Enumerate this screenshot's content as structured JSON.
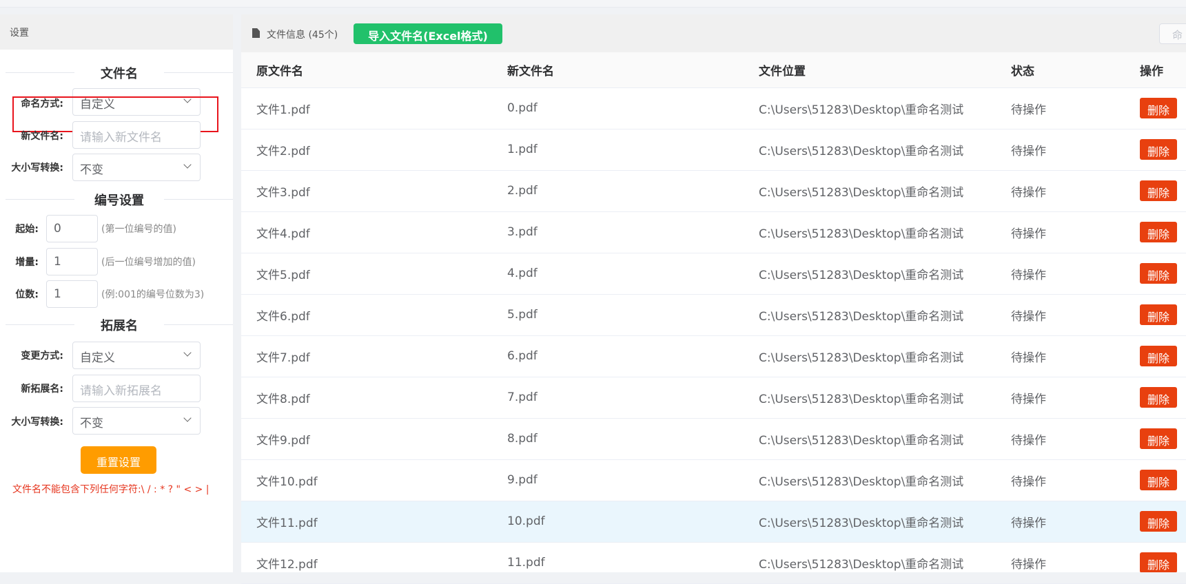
{
  "settings": {
    "title": "设置",
    "filename_section": "文件名",
    "naming_label": "命名方式:",
    "naming_value": "自定义",
    "newname_label": "新文件名:",
    "newname_placeholder": "请输入新文件名",
    "case_label": "大小写转换:",
    "case_value": "不变",
    "numbering_section": "编号设置",
    "start_label": "起始:",
    "start_value": "0",
    "start_hint": "(第一位编号的值)",
    "increment_label": "增量:",
    "increment_value": "1",
    "increment_hint": "(后一位编号增加的值)",
    "digits_label": "位数:",
    "digits_value": "1",
    "digits_hint": "(例:001的编号位数为3)",
    "ext_section": "拓展名",
    "ext_mode_label": "变更方式:",
    "ext_mode_value": "自定义",
    "newext_label": "新拓展名:",
    "newext_placeholder": "请输入新拓展名",
    "ext_case_label": "大小写转换:",
    "ext_case_value": "不变",
    "reset_label": "重置设置",
    "warning": "文件名不能包含下列任何字符:\\ / : * ? \" < > |"
  },
  "toolbar": {
    "info": "文件信息 (45个)",
    "import_label": "导入文件名(Excel格式)",
    "rename_label": "命"
  },
  "table": {
    "headers": [
      "原文件名",
      "新文件名",
      "文件位置",
      "状态",
      "操作"
    ],
    "delete_label": "删除",
    "rows": [
      {
        "orig": "文件1.pdf",
        "new": "0.pdf",
        "path": "C:\\Users\\51283\\Desktop\\重命名测试",
        "status": "待操作"
      },
      {
        "orig": "文件2.pdf",
        "new": "1.pdf",
        "path": "C:\\Users\\51283\\Desktop\\重命名测试",
        "status": "待操作"
      },
      {
        "orig": "文件3.pdf",
        "new": "2.pdf",
        "path": "C:\\Users\\51283\\Desktop\\重命名测试",
        "status": "待操作"
      },
      {
        "orig": "文件4.pdf",
        "new": "3.pdf",
        "path": "C:\\Users\\51283\\Desktop\\重命名测试",
        "status": "待操作"
      },
      {
        "orig": "文件5.pdf",
        "new": "4.pdf",
        "path": "C:\\Users\\51283\\Desktop\\重命名测试",
        "status": "待操作"
      },
      {
        "orig": "文件6.pdf",
        "new": "5.pdf",
        "path": "C:\\Users\\51283\\Desktop\\重命名测试",
        "status": "待操作"
      },
      {
        "orig": "文件7.pdf",
        "new": "6.pdf",
        "path": "C:\\Users\\51283\\Desktop\\重命名测试",
        "status": "待操作"
      },
      {
        "orig": "文件8.pdf",
        "new": "7.pdf",
        "path": "C:\\Users\\51283\\Desktop\\重命名测试",
        "status": "待操作"
      },
      {
        "orig": "文件9.pdf",
        "new": "8.pdf",
        "path": "C:\\Users\\51283\\Desktop\\重命名测试",
        "status": "待操作"
      },
      {
        "orig": "文件10.pdf",
        "new": "9.pdf",
        "path": "C:\\Users\\51283\\Desktop\\重命名测试",
        "status": "待操作"
      },
      {
        "orig": "文件11.pdf",
        "new": "10.pdf",
        "path": "C:\\Users\\51283\\Desktop\\重命名测试",
        "status": "待操作"
      },
      {
        "orig": "文件12.pdf",
        "new": "11.pdf",
        "path": "C:\\Users\\51283\\Desktop\\重命名测试",
        "status": "待操作"
      }
    ]
  },
  "colors": {
    "import_green": "#21c16b",
    "reset_orange": "#ff9c00",
    "delete_red": "#e8400f",
    "highlight_red": "#e8141c",
    "row_highlight": "#eaf6fd"
  }
}
